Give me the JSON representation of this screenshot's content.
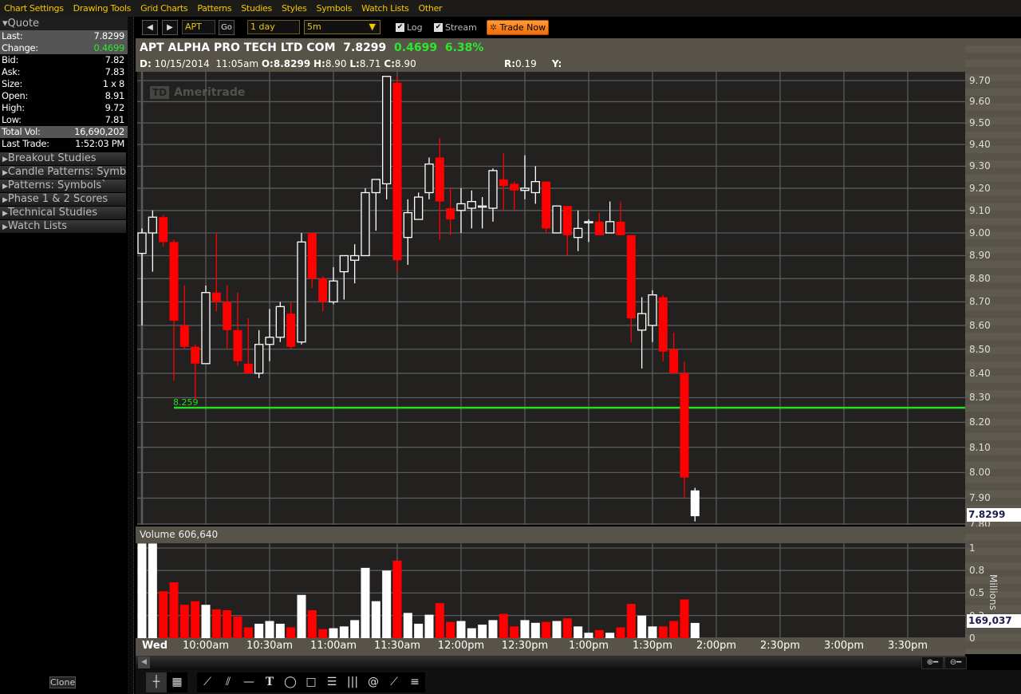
{
  "menu": [
    "Chart Settings",
    "Drawing Tools",
    "Grid Charts",
    "Patterns",
    "Studies",
    "Styles",
    "Symbols",
    "Watch Lists",
    "Other"
  ],
  "quote": {
    "title": "Quote",
    "rows": [
      {
        "label": "Last:",
        "value": "7.8299",
        "hl": true
      },
      {
        "label": "Change:",
        "value": "0.4699",
        "hl": true,
        "green": true
      },
      {
        "label": "Bid:",
        "value": "7.82"
      },
      {
        "label": "Ask:",
        "value": "7.83"
      },
      {
        "label": "Size:",
        "value": "1 x 8"
      },
      {
        "label": "Open:",
        "value": "8.91"
      },
      {
        "label": "High:",
        "value": "9.72"
      },
      {
        "label": "Low:",
        "value": "7.81"
      },
      {
        "label": "Total Vol:",
        "value": "16,690,202",
        "hl": true
      },
      {
        "label": "Last Trade:",
        "value": "1:52:03 PM"
      }
    ]
  },
  "sections": [
    "Breakout Studies",
    "Candle Patterns: Symbols",
    "Patterns: Symbols`",
    "Phase 1 & 2 Scores",
    "Technical Studies",
    "Watch Lists"
  ],
  "clone_label": "Clone",
  "toolbar": {
    "symbol": "APT",
    "go": "Go",
    "period": "1 day",
    "interval": "5m",
    "log_label": "Log",
    "log_checked": true,
    "stream_label": "Stream",
    "stream_checked": true,
    "trade_now": "Trade Now"
  },
  "header": {
    "name": "APT ALPHA PRO TECH LTD COM",
    "last": "7.8299",
    "change": "0.4699",
    "change_pct": "6.38%",
    "d_label": "D:",
    "date": "10/15/2014",
    "time": "11:05am",
    "o_label": "O:",
    "o": "8.8299",
    "h_label": "H:",
    "h": "8.90",
    "l_label": "L:",
    "l": "8.71",
    "c_label": "C:",
    "c": "8.90",
    "r_label": "R:",
    "r": "0.19",
    "y_label": "Y:"
  },
  "watermark": {
    "logo": "TD",
    "text": "Ameritrade"
  },
  "colors": {
    "up": "#ffffff",
    "down": "#ff0000",
    "line": "#22dd22",
    "grid": "#5a5a5a",
    "bg": "#22211f"
  },
  "chart_data": {
    "type": "candlestick",
    "symbol": "APT",
    "interval": "5m",
    "start_time": "9:30am",
    "price_scale": "log",
    "ylim": [
      7.8,
      9.72
    ],
    "price_ticks": [
      "9.70",
      "9.60",
      "9.50",
      "9.40",
      "9.30",
      "9.20",
      "9.10",
      "9.00",
      "8.90",
      "8.80",
      "8.70",
      "8.60",
      "8.50",
      "8.40",
      "8.30",
      "8.20",
      "8.10",
      "8.00",
      "7.90",
      "7.80"
    ],
    "last_price_tag": "7.8299",
    "horizontal_line": {
      "value": 8.259,
      "label": "8.259"
    },
    "columns": [
      "open",
      "high",
      "low",
      "close",
      "volume_millions"
    ],
    "candles": [
      [
        8.91,
        9.02,
        8.6,
        9.0,
        1.05
      ],
      [
        9.0,
        9.1,
        8.83,
        9.07,
        1.05
      ],
      [
        9.07,
        9.08,
        8.94,
        8.96,
        0.52
      ],
      [
        8.96,
        8.97,
        8.37,
        8.62,
        0.62
      ],
      [
        8.6,
        8.77,
        8.5,
        8.51,
        0.37
      ],
      [
        8.51,
        8.52,
        8.29,
        8.44,
        0.41
      ],
      [
        8.44,
        8.77,
        8.44,
        8.74,
        0.37
      ],
      [
        8.74,
        9.0,
        8.66,
        8.7,
        0.32
      ],
      [
        8.7,
        8.77,
        8.5,
        8.58,
        0.31
      ],
      [
        8.58,
        8.74,
        8.43,
        8.45,
        0.24
      ],
      [
        8.44,
        8.63,
        8.4,
        8.4,
        0.12
      ],
      [
        8.4,
        8.58,
        8.38,
        8.52,
        0.16
      ],
      [
        8.52,
        8.67,
        8.45,
        8.55,
        0.19
      ],
      [
        8.55,
        8.7,
        8.53,
        8.68,
        0.16
      ],
      [
        8.65,
        8.7,
        8.5,
        8.51,
        0.12
      ],
      [
        8.53,
        9.0,
        8.52,
        8.96,
        0.48
      ],
      [
        9.0,
        9.0,
        8.76,
        8.8,
        0.31
      ],
      [
        8.8,
        8.81,
        8.66,
        8.7,
        0.1
      ],
      [
        8.7,
        8.85,
        8.69,
        8.79,
        0.11
      ],
      [
        8.83,
        8.9,
        8.71,
        8.9,
        0.13
      ],
      [
        8.88,
        8.95,
        8.78,
        8.9,
        0.2
      ],
      [
        8.9,
        9.2,
        8.9,
        9.18,
        0.78
      ],
      [
        9.18,
        9.24,
        9.01,
        9.24,
        0.41
      ],
      [
        9.22,
        9.72,
        9.15,
        9.72,
        0.75
      ],
      [
        9.69,
        9.72,
        8.83,
        8.88,
        0.86
      ],
      [
        8.98,
        9.15,
        8.86,
        9.09,
        0.28
      ],
      [
        9.06,
        9.18,
        9.06,
        9.16,
        0.16
      ],
      [
        9.18,
        9.34,
        9.15,
        9.31,
        0.26
      ],
      [
        9.34,
        9.43,
        8.97,
        9.14,
        0.39
      ],
      [
        9.11,
        9.2,
        8.99,
        9.06,
        0.18
      ],
      [
        9.1,
        9.2,
        9.0,
        9.13,
        0.19
      ],
      [
        9.11,
        9.19,
        9.02,
        9.14,
        0.11
      ],
      [
        9.12,
        9.16,
        9.02,
        9.12,
        0.15
      ],
      [
        9.11,
        9.29,
        9.05,
        9.28,
        0.2
      ],
      [
        9.24,
        9.36,
        9.1,
        9.21,
        0.27
      ],
      [
        9.22,
        9.23,
        9.1,
        9.19,
        0.13
      ],
      [
        9.19,
        9.35,
        9.15,
        9.2,
        0.2
      ],
      [
        9.18,
        9.3,
        9.13,
        9.23,
        0.17
      ],
      [
        9.23,
        9.23,
        9.0,
        9.02,
        0.18
      ],
      [
        9.0,
        9.12,
        9.0,
        9.12,
        0.19
      ],
      [
        9.12,
        9.12,
        8.9,
        8.99,
        0.22
      ],
      [
        8.98,
        9.1,
        8.92,
        9.02,
        0.13
      ],
      [
        9.05,
        9.06,
        8.96,
        9.05,
        0.06
      ],
      [
        9.05,
        9.09,
        8.99,
        8.99,
        0.09
      ],
      [
        9.0,
        9.14,
        9.0,
        9.05,
        0.06
      ],
      [
        9.05,
        9.14,
        8.99,
        8.99,
        0.12
      ],
      [
        8.99,
        8.99,
        8.53,
        8.63,
        0.38
      ],
      [
        8.58,
        8.72,
        8.42,
        8.65,
        0.25
      ],
      [
        8.6,
        8.75,
        8.53,
        8.73,
        0.13
      ],
      [
        8.72,
        8.73,
        8.45,
        8.49,
        0.13
      ],
      [
        8.5,
        8.57,
        8.4,
        8.4,
        0.19
      ],
      [
        8.4,
        8.45,
        7.9,
        7.98,
        0.43
      ],
      [
        7.93,
        7.94,
        7.81,
        7.83,
        0.169
      ]
    ],
    "time_labels": [
      "Wed",
      "10:00am",
      "10:30am",
      "11:00am",
      "11:30am",
      "12:00pm",
      "12:30pm",
      "1:00pm",
      "1:30pm",
      "2:00pm",
      "2:30pm",
      "3:00pm",
      "3:30pm"
    ],
    "volume": {
      "label": "Volume",
      "value": "606,640",
      "unit": "Millions",
      "ticks": [
        "1",
        "0.8",
        "0.5",
        "0.3",
        "0"
      ],
      "ylim": [
        0,
        1
      ],
      "last_tag": "169,037"
    }
  },
  "drawing_tools": [
    "crosshair-cursor",
    "select-region",
    "pencil",
    "parallel-lines",
    "horizontal-line",
    "text",
    "ellipse",
    "rectangle",
    "fibonacci-retracement",
    "fibonacci-timezones",
    "spiral",
    "fan-lines",
    "horizontal-levels"
  ]
}
